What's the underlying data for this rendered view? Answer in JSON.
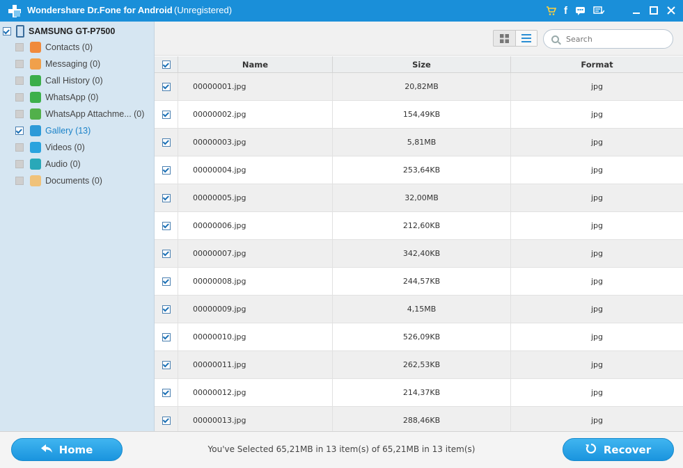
{
  "window": {
    "title": "Wondershare Dr.Fone for Android",
    "registration": "(Unregistered)",
    "colors": {
      "titlebar": "#1a8fd9",
      "accent": "#1a82c8"
    }
  },
  "sidebar": {
    "device": "SAMSUNG GT-P7500",
    "items": [
      {
        "label": "Contacts (0)",
        "icon": "contacts-icon",
        "color": "#f08a3c",
        "checked": false
      },
      {
        "label": "Messaging (0)",
        "icon": "messaging-icon",
        "color": "#f0a04a",
        "checked": false
      },
      {
        "label": "Call History  (0)",
        "icon": "call-history-icon",
        "color": "#3cae4a",
        "checked": false
      },
      {
        "label": "WhatsApp  (0)",
        "icon": "whatsapp-icon",
        "color": "#3cb04a",
        "checked": false
      },
      {
        "label": "WhatsApp Attachme...  (0)",
        "icon": "attachment-icon",
        "color": "#52b04a",
        "checked": false
      },
      {
        "label": "Gallery (13)",
        "icon": "gallery-icon",
        "color": "#2d9ad8",
        "checked": true
      },
      {
        "label": "Videos (0)",
        "icon": "videos-icon",
        "color": "#2aa3de",
        "checked": false
      },
      {
        "label": "Audio (0)",
        "icon": "audio-icon",
        "color": "#29a8b8",
        "checked": false
      },
      {
        "label": "Documents (0)",
        "icon": "documents-icon",
        "color": "#f0c27a",
        "checked": false
      }
    ]
  },
  "toolbar": {
    "search_placeholder": "Search"
  },
  "table": {
    "headers": {
      "name": "Name",
      "size": "Size",
      "format": "Format"
    },
    "rows": [
      {
        "name": "00000001.jpg",
        "size": "20,82MB",
        "format": "jpg"
      },
      {
        "name": "00000002.jpg",
        "size": "154,49KB",
        "format": "jpg"
      },
      {
        "name": "00000003.jpg",
        "size": "5,81MB",
        "format": "jpg"
      },
      {
        "name": "00000004.jpg",
        "size": "253,64KB",
        "format": "jpg"
      },
      {
        "name": "00000005.jpg",
        "size": "32,00MB",
        "format": "jpg"
      },
      {
        "name": "00000006.jpg",
        "size": "212,60KB",
        "format": "jpg"
      },
      {
        "name": "00000007.jpg",
        "size": "342,40KB",
        "format": "jpg"
      },
      {
        "name": "00000008.jpg",
        "size": "244,57KB",
        "format": "jpg"
      },
      {
        "name": "00000009.jpg",
        "size": "4,15MB",
        "format": "jpg"
      },
      {
        "name": "00000010.jpg",
        "size": "526,09KB",
        "format": "jpg"
      },
      {
        "name": "00000011.jpg",
        "size": "262,53KB",
        "format": "jpg"
      },
      {
        "name": "00000012.jpg",
        "size": "214,37KB",
        "format": "jpg"
      },
      {
        "name": "00000013.jpg",
        "size": "288,46KB",
        "format": "jpg"
      }
    ]
  },
  "footer": {
    "home_label": "Home",
    "recover_label": "Recover",
    "status": "You've Selected 65,21MB in 13 item(s) of 65,21MB in 13 item(s)"
  }
}
